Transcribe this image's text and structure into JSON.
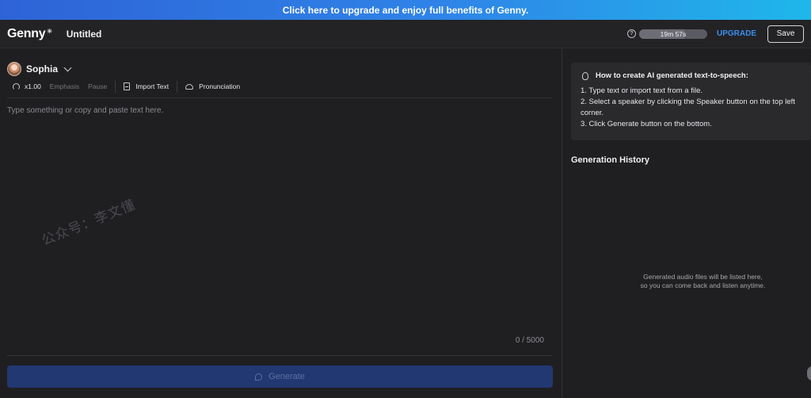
{
  "banner": {
    "text": "Click here to upgrade and enjoy full benefits of Genny."
  },
  "header": {
    "logo": "Genny",
    "logo_mark": "✳",
    "doc_title": "Untitled",
    "quota_time": "19m 57s",
    "quota_fraction": 0.66,
    "upgrade_label": "UPGRADE",
    "save_label": "Save"
  },
  "editor": {
    "speaker_name": "Sophia",
    "speed": "x1.00",
    "emphasis_label": "Emphasis",
    "pause_label": "Pause",
    "import_label": "Import Text",
    "pronunciation_label": "Pronunciation",
    "placeholder": "Type something or copy and paste text here.",
    "counter": "0 / 5000",
    "generate_label": "Generate",
    "watermark": "公众号：李文懂"
  },
  "howto": {
    "title": "How to create AI generated text-to-speech:",
    "steps": [
      "1. Type text or import text from a file.",
      "2. Select a speaker by clicking the Speaker button on the top left corner.",
      "3. Click Generate button on the bottom."
    ]
  },
  "history": {
    "title": "Generation History",
    "empty_line1": "Generated audio files will be listed here,",
    "empty_line2": "so you can come back and listen anytime."
  },
  "colors": {
    "background": "#1f1f21",
    "accent": "#3b8df0",
    "generate_button": "#223872"
  }
}
